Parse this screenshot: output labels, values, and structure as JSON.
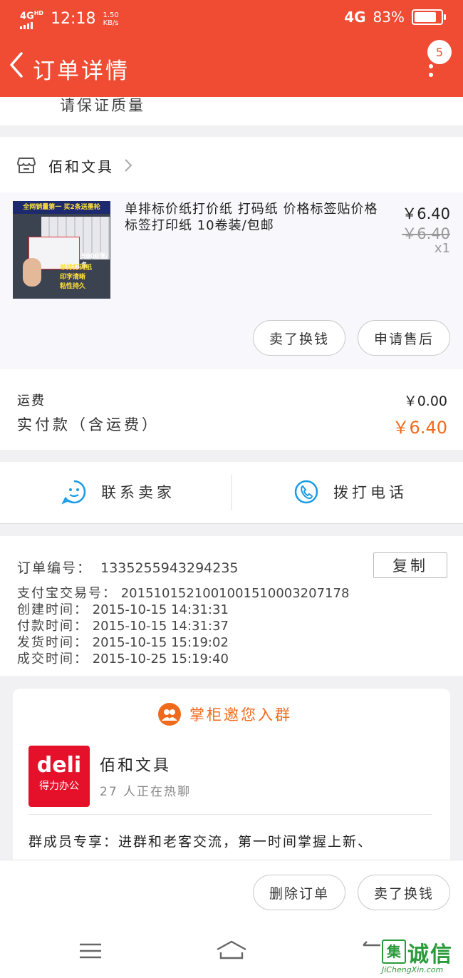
{
  "status": {
    "network": "4G",
    "hd": "HD",
    "time": "12:18",
    "speed_value": "1.50",
    "speed_unit": "KB/s",
    "carrier_net": "4G",
    "battery": "83%",
    "battery_level": 0.83
  },
  "header": {
    "title": "订单详情",
    "badge_count": "5"
  },
  "cutoff_text": "请保证质量",
  "shop": {
    "name": "佰和文具"
  },
  "product": {
    "thumb_banner": "全网销量第一  买2条送墨轮",
    "thumb_count": "5000张/条",
    "thumb_features": [
      "单排打码纸",
      "印字清晰",
      "粘性持久"
    ],
    "title": "单排标价纸打价纸 打码纸 价格标签贴价格标签打印纸 10卷装/包邮",
    "price": "￥6.40",
    "original_price": "￥6.40",
    "quantity": "x1"
  },
  "item_actions": {
    "sell": "卖了换钱",
    "after_sale": "申请售后"
  },
  "fees": {
    "shipping_label": "运费",
    "shipping_value": "￥0.00",
    "paid_label": "实付款（含运费）",
    "paid_value": "￥6.40"
  },
  "contact": {
    "seller": "联系卖家",
    "call": "拨打电话"
  },
  "order_info": {
    "order_no_label": "订单编号：",
    "order_no": "1335255943294235",
    "copy": "复制",
    "rows": [
      {
        "label": "支付宝交易号：",
        "value": "2015101521001001510003207178"
      },
      {
        "label": "创建时间：",
        "value": "2015-10-15 14:31:31"
      },
      {
        "label": "付款时间：",
        "value": "2015-10-15 14:31:37"
      },
      {
        "label": "发货时间：",
        "value": "2015-10-15 15:19:02"
      },
      {
        "label": "成交时间：",
        "value": "2015-10-25 15:19:40"
      }
    ]
  },
  "group": {
    "title": "掌柜邀您入群",
    "logo_brand": "deli",
    "logo_sub": "得力办公",
    "shop_name": "佰和文具",
    "members": "27 人正在热聊",
    "desc": "群成员专享：进群和老客交流，第一时间掌握上新、"
  },
  "bottom_actions": {
    "delete": "删除订单",
    "sell": "卖了换钱"
  },
  "watermark": {
    "text": "诚信",
    "url": "JiChengXin.com"
  },
  "colors": {
    "header": "#f04b33",
    "accent_orange": "#f06a1c",
    "contact_blue": "#1a9be6"
  }
}
